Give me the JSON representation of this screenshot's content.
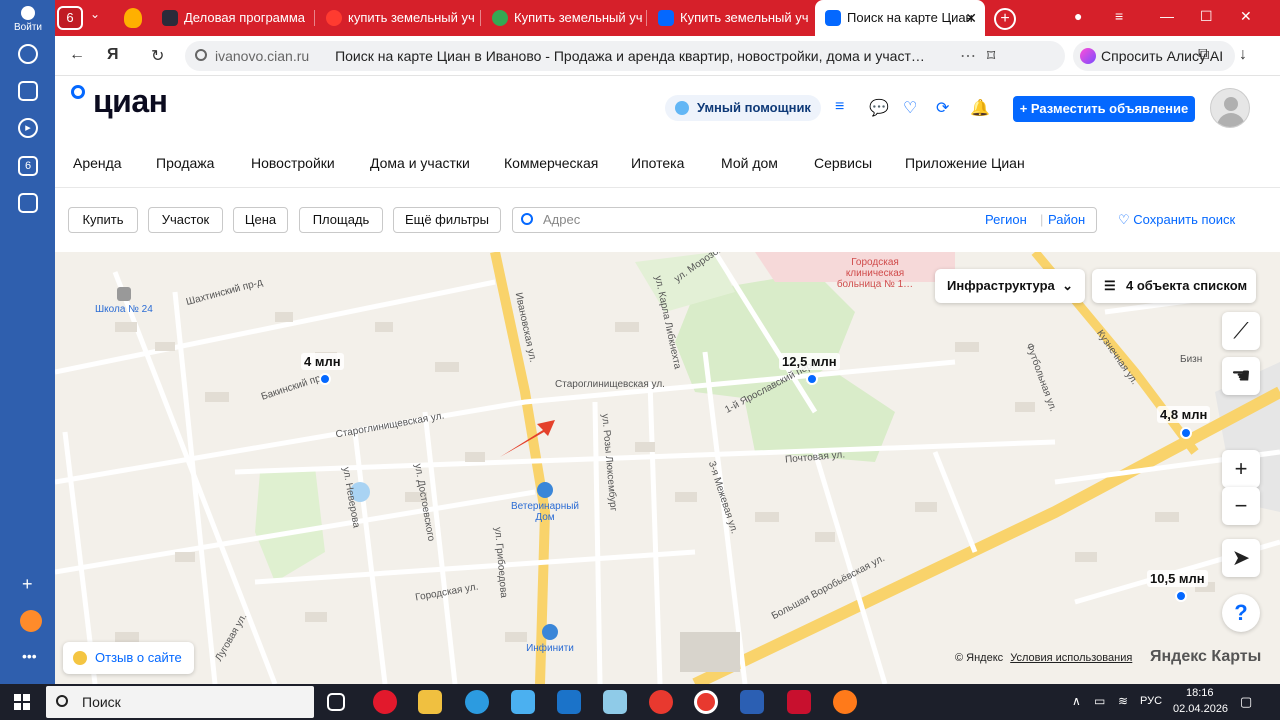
{
  "sidebar": {
    "login_label": "Войти",
    "tab_count": "6"
  },
  "tabs": [
    {
      "title": "Деловая программа",
      "color": "#2b2b3a"
    },
    {
      "title": "купить земельный уч",
      "color": "#ff3b30"
    },
    {
      "title": "Купить земельный уч",
      "color": "#34a853"
    },
    {
      "title": "Купить земельный уч",
      "color": "#0468ff"
    },
    {
      "title": "Поиск на карте Циан",
      "color": "#0468ff",
      "active": true
    }
  ],
  "addressbar": {
    "domain": "ivanovo.cian.ru",
    "title": "Поиск на карте Циан в Иваново - Продажа и аренда квартир, новостройки, дома и участ…",
    "alisa": "Спросить Алису AI"
  },
  "header": {
    "logo": "циан",
    "assistant": "Умный помощник",
    "post_button": "+ Разместить объявление"
  },
  "nav": [
    "Аренда",
    "Продажа",
    "Новостройки",
    "Дома и участки",
    "Коммерческая",
    "Ипотека",
    "Мой дом",
    "Сервисы",
    "Приложение Циан"
  ],
  "filters": {
    "buttons": [
      "Купить",
      "Участок",
      "Цена",
      "Площадь",
      "Ещё фильтры"
    ],
    "address_placeholder": "Адрес",
    "region": "Регион",
    "district": "Район",
    "save_search": "Сохранить поиск"
  },
  "map": {
    "infrastructure": "Инфраструктура",
    "list_button": "4 объекта списком",
    "prices": [
      "4 млн",
      "12,5 млн",
      "4,8 млн",
      "10,5 млн"
    ],
    "streets": [
      "Ивановская ул.",
      "Староглинищевская ул.",
      "Старoглинищевская ул.",
      "Бакинский пр.",
      "Шахтинский пр-д",
      "ул. Карла Либкнехта",
      "ул. Розы Люксембург",
      "Почтовая ул.",
      "Кузнечная ул.",
      "Большая Воробьёвская ул.",
      "Городская ул.",
      "ул. Неверова",
      "ул. Достоевского",
      "ул. Грибоедова",
      "1-й Ярославский пер.",
      "3-я Межевая ул.",
      "Футбольная ул.",
      "ул. Морозова",
      "Луговая ул."
    ],
    "pois": [
      "Школа № 24",
      "Ветеринарный Дом",
      "Инфинити",
      "Городская клиническая больница № 1…",
      "Бизн"
    ],
    "feedback": "Отзыв о сайте",
    "copyright": "© Яндекс",
    "terms": "Условия использования",
    "provider": "Яндекс Карты"
  },
  "taskbar": {
    "search": "Поиск",
    "lang": "РУС",
    "time": "18:16",
    "date": "02.04.2026"
  }
}
